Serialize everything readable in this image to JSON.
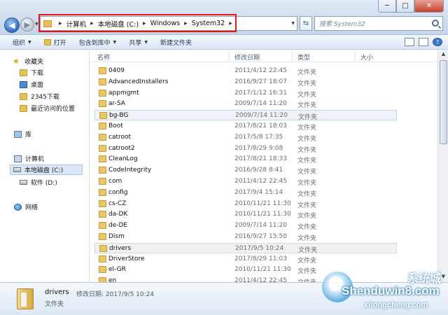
{
  "window": {
    "controls": {
      "minimize": "─",
      "maximize": "□",
      "close": "✕"
    }
  },
  "address_bar": {
    "crumbs": [
      "计算机",
      "本地磁盘 (C:)",
      "Windows",
      "System32"
    ]
  },
  "search": {
    "placeholder": "搜索 System32"
  },
  "toolbar": {
    "organize": "组织",
    "open": "打开",
    "include_in_library": "包含到库中",
    "share": "共享",
    "new_folder": "新建文件夹"
  },
  "navigation": {
    "favorites": "收藏夹",
    "downloads": "下载",
    "desktop": "桌面",
    "downloads_2345": "2345下载",
    "recent_places": "最近访问的位置",
    "libraries": "库",
    "computer": "计算机",
    "local_disk_c": "本地磁盘 (C:)",
    "software_d": "软件 (D:)",
    "network": "网络"
  },
  "columns": {
    "name": "名称",
    "date_modified": "修改日期",
    "type": "类型",
    "size": "大小"
  },
  "files": [
    {
      "name": "0409",
      "date": "2011/4/12 22:45",
      "type": "文件夹"
    },
    {
      "name": "AdvancedInstallers",
      "date": "2016/9/27 18:07",
      "type": "文件夹"
    },
    {
      "name": "appmgmt",
      "date": "2017/1/12 16:31",
      "type": "文件夹"
    },
    {
      "name": "ar-SA",
      "date": "2009/7/14 11:20",
      "type": "文件夹"
    },
    {
      "name": "bg-BG",
      "date": "2009/7/14 11:20",
      "type": "文件夹"
    },
    {
      "name": "Boot",
      "date": "2017/8/21 18:03",
      "type": "文件夹"
    },
    {
      "name": "catroot",
      "date": "2017/5/8 17:35",
      "type": "文件夹"
    },
    {
      "name": "catroot2",
      "date": "2017/8/29 9:08",
      "type": "文件夹"
    },
    {
      "name": "CleanLog",
      "date": "2017/8/21 18:33",
      "type": "文件夹"
    },
    {
      "name": "CodeIntegrity",
      "date": "2016/9/28 8:41",
      "type": "文件夹"
    },
    {
      "name": "com",
      "date": "2011/4/12 22:45",
      "type": "文件夹"
    },
    {
      "name": "config",
      "date": "2017/9/4 15:14",
      "type": "文件夹"
    },
    {
      "name": "cs-CZ",
      "date": "2010/11/21 11:30",
      "type": "文件夹"
    },
    {
      "name": "da-DK",
      "date": "2010/11/21 11:30",
      "type": "文件夹"
    },
    {
      "name": "de-DE",
      "date": "2009/7/14 11:20",
      "type": "文件夹"
    },
    {
      "name": "Dism",
      "date": "2016/9/27 15:50",
      "type": "文件夹"
    },
    {
      "name": "drivers",
      "date": "2017/9/5 10:24",
      "type": "文件夹"
    },
    {
      "name": "DriverStore",
      "date": "2017/8/29 11:03",
      "type": "文件夹"
    },
    {
      "name": "el-GR",
      "date": "2010/11/21 11:30",
      "type": "文件夹"
    },
    {
      "name": "en",
      "date": "2011/4/12 22:45",
      "type": "文件夹"
    }
  ],
  "details_pane": {
    "name": "drivers",
    "modified": "修改日期: 2017/9/5 10:24",
    "type": "文件夹"
  },
  "watermark": {
    "site": "Shenduwin8.com",
    "domain": "xitongcheng.com",
    "cn": "系统城"
  },
  "colors": {
    "highlight_box": "#e4161b",
    "selection": "#dbe7f6",
    "folder": "#e8c05a"
  }
}
